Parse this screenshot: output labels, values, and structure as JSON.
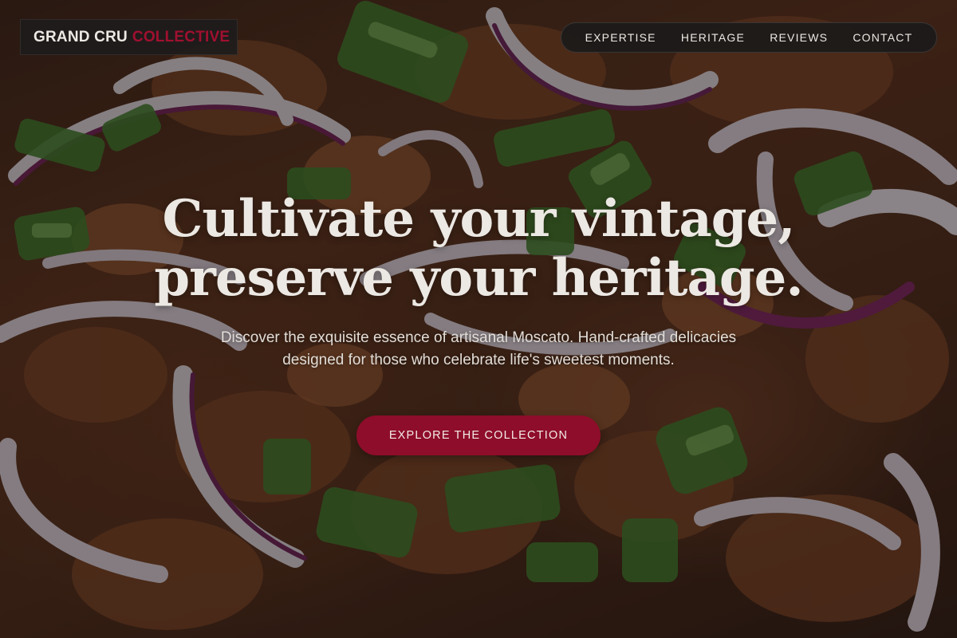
{
  "logo": {
    "primary": "GRAND CRU",
    "accent": "COLLECTIVE",
    "accent_color": "#a0102f"
  },
  "nav": {
    "items": [
      {
        "label": "EXPERTISE"
      },
      {
        "label": "HERITAGE"
      },
      {
        "label": "REVIEWS"
      },
      {
        "label": "CONTACT"
      }
    ]
  },
  "hero": {
    "headline_line1": "Cultivate your vintage,",
    "headline_line2": "preserve your heritage.",
    "subtext": "Discover the exquisite essence of artisanal Moscato. Hand-crafted delicacies designed for those who celebrate life's sweetest moments.",
    "cta_label": "EXPLORE THE COLLECTION",
    "cta_color": "#8e0d2a"
  }
}
